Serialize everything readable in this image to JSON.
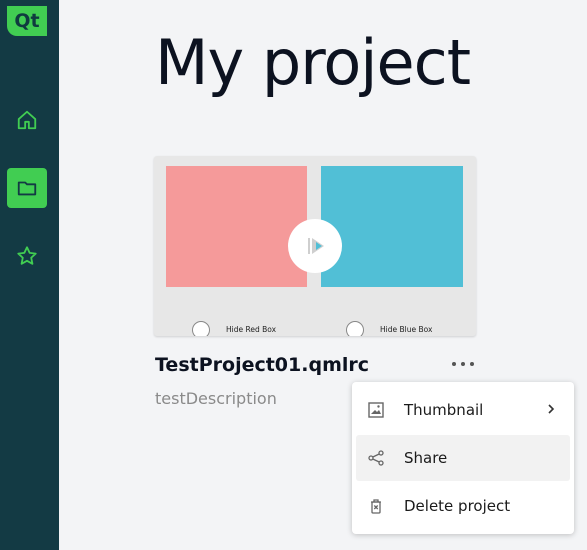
{
  "sidebar": {
    "logo": "Qt",
    "items": [
      {
        "icon": "home-icon"
      },
      {
        "icon": "folder-icon",
        "active": true
      },
      {
        "icon": "star-icon"
      }
    ],
    "bg_color": "#133a44",
    "accent": "#41cd52"
  },
  "main": {
    "title": "My project",
    "project": {
      "name": "TestProject01.qmlrc",
      "description": "testDescription",
      "thumbnail": {
        "toggle_red_label": "Hide Red Box",
        "toggle_blue_label": "Hide Blue Box",
        "red_color": "#f59a9a",
        "blue_color": "#51bfd6"
      }
    }
  },
  "context_menu": {
    "items": [
      {
        "label": "Thumbnail",
        "icon": "image-icon",
        "submenu": true
      },
      {
        "label": "Share",
        "icon": "share-icon",
        "hovered": true
      },
      {
        "label": "Delete project",
        "icon": "trash-icon"
      }
    ]
  }
}
